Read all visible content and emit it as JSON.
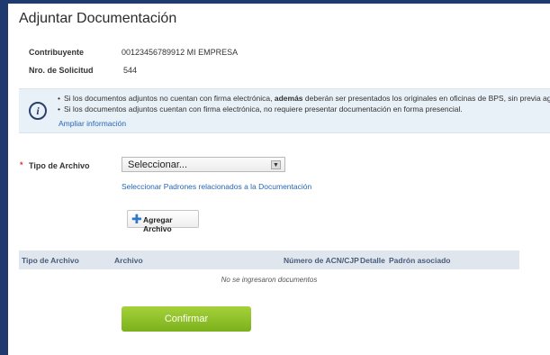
{
  "page": {
    "title": "Adjuntar Documentación"
  },
  "details": {
    "contribuyente_label": "Contribuyente",
    "contribuyente_value": "00123456789912 MI EMPRESA",
    "solicitud_label": "Nro. de Solicitud",
    "solicitud_value": "544"
  },
  "info": {
    "icon": "info-icon",
    "line1_pre": "Si los documentos adjuntos no cuentan con firma electrónica, ",
    "line1_bold": "además",
    "line1_post": " deberán ser presentados los originales en oficinas de BPS, sin previa agenda.",
    "line2": "Si los documentos adjuntos cuentan con firma electrónica, no requiere presentar documentación en forma presencial.",
    "link": "Ampliar información"
  },
  "form": {
    "required_mark": "*",
    "tipo_label": "Tipo de Archivo",
    "select_value": "Seleccionar...",
    "padrones_link": "Seleccionar Padrones relacionados a la Documentación",
    "agregar_label": "Agregar Archivo"
  },
  "table": {
    "columns": [
      "Tipo de Archivo",
      "Archivo",
      "Número de ACN/CJP",
      "Detalle",
      "Padrón asociado"
    ],
    "empty_message": "No se ingresaron documentos"
  },
  "actions": {
    "confirm_label": "Confirmar"
  },
  "colors": {
    "frame": "#1f3a6e",
    "link": "#2766b3",
    "confirm": "#8dc22a"
  }
}
